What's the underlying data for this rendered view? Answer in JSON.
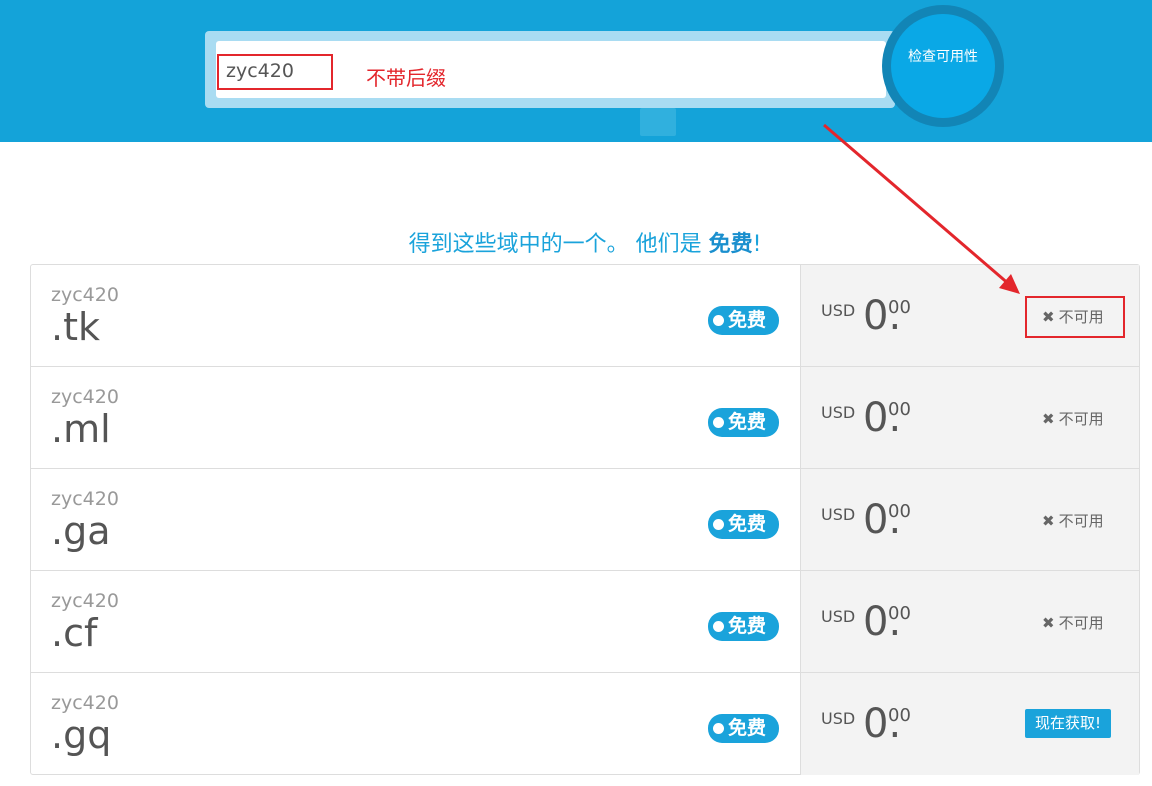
{
  "search": {
    "value": "zyc420",
    "hint_annotation": "不带后缀",
    "check_button_label": "检查可用性"
  },
  "tagline": {
    "text_before": "得到这些域中的一个。 他们是 ",
    "emphasis": "免费",
    "text_after": "!"
  },
  "results": [
    {
      "name": "zyc420",
      "tld": ".tk",
      "badge": "免费",
      "currency": "USD",
      "price_main": "0.",
      "price_cents": "00",
      "status": "不可用",
      "available": false
    },
    {
      "name": "zyc420",
      "tld": ".ml",
      "badge": "免费",
      "currency": "USD",
      "price_main": "0.",
      "price_cents": "00",
      "status": "不可用",
      "available": false
    },
    {
      "name": "zyc420",
      "tld": ".ga",
      "badge": "免费",
      "currency": "USD",
      "price_main": "0.",
      "price_cents": "00",
      "status": "不可用",
      "available": false
    },
    {
      "name": "zyc420",
      "tld": ".cf",
      "badge": "免费",
      "currency": "USD",
      "price_main": "0.",
      "price_cents": "00",
      "status": "不可用",
      "available": false
    },
    {
      "name": "zyc420",
      "tld": ".gq",
      "badge": "免费",
      "currency": "USD",
      "price_main": "0.",
      "price_cents": "00",
      "status": "现在获取!",
      "available": true
    }
  ],
  "icons": {
    "unavailable": "close-icon",
    "badge_dot": "dot-icon"
  },
  "colors": {
    "hero_bg": "#14a3d9",
    "accent": "#1aa3db",
    "annotation": "#e3262c"
  }
}
